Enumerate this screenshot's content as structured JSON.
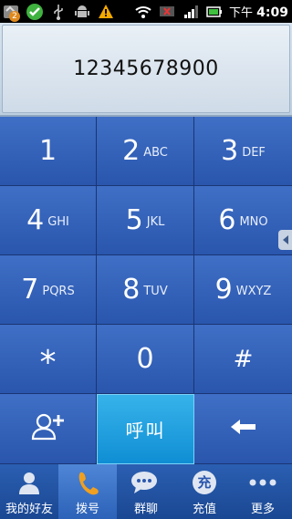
{
  "status_bar": {
    "time_prefix": "下午",
    "time": "4:09",
    "notification_badge": "2"
  },
  "dialer": {
    "number": "12345678900"
  },
  "keypad": {
    "keys": [
      {
        "digit": "1",
        "letters": ""
      },
      {
        "digit": "2",
        "letters": "ABC"
      },
      {
        "digit": "3",
        "letters": "DEF"
      },
      {
        "digit": "4",
        "letters": "GHI"
      },
      {
        "digit": "5",
        "letters": "JKL"
      },
      {
        "digit": "6",
        "letters": "MNO"
      },
      {
        "digit": "7",
        "letters": "PQRS"
      },
      {
        "digit": "8",
        "letters": "TUV"
      },
      {
        "digit": "9",
        "letters": "WXYZ"
      },
      {
        "digit": "*",
        "letters": ""
      },
      {
        "digit": "0",
        "letters": ""
      },
      {
        "digit": "#",
        "letters": ""
      }
    ],
    "call_label": "呼叫"
  },
  "tabs": [
    {
      "label": "我的好友",
      "icon": "person-icon"
    },
    {
      "label": "拨号",
      "icon": "phone-icon"
    },
    {
      "label": "群聊",
      "icon": "chat-bubbles-icon"
    },
    {
      "label": "充值",
      "icon": "recharge-icon",
      "icon_text": "充"
    },
    {
      "label": "更多",
      "icon": "more-dots-icon"
    }
  ],
  "colors": {
    "key_blue": "#2a56ad",
    "call_blue": "#0f8ed4",
    "tab_bar": "#1a4792"
  }
}
